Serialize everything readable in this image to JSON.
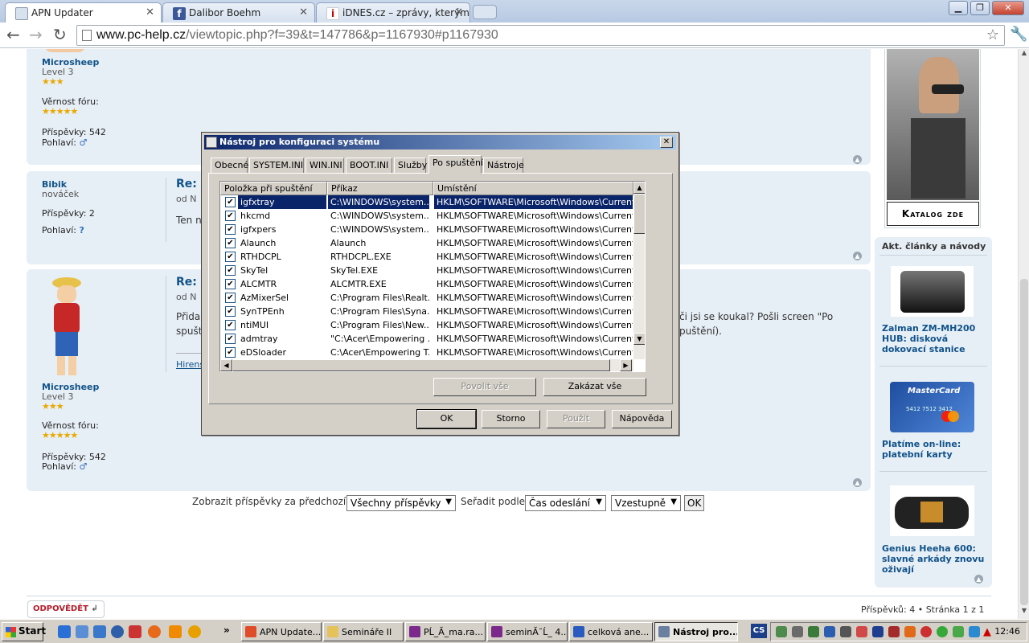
{
  "browser": {
    "tabs": [
      {
        "title": "APN Updater",
        "active": true
      },
      {
        "title": "Dalibor Boehm",
        "active": false
      },
      {
        "title": "iDNES.cz – zprávy, kterým m",
        "active": false
      }
    ],
    "url_host": "www.pc-help.cz",
    "url_path": "/viewtopic.php?f=39&t=147786&p=1167930#p1167930"
  },
  "page": {
    "post1": {
      "username": "Microsheep",
      "rank": "Level 3",
      "loyalty_label": "Věrnost fóru:",
      "posts_label": "Příspěvky:",
      "posts_value": "542",
      "gender_label": "Pohlaví:"
    },
    "post2": {
      "username": "Bibik",
      "rank": "nováček",
      "posts_label": "Příspěvky:",
      "posts_value": "2",
      "gender_label": "Pohlaví:",
      "title": "Re: A",
      "meta": "od N",
      "text": "Ten n"
    },
    "post3": {
      "username": "Microsheep",
      "rank": "Level 3",
      "loyalty_label": "Věrnost fóru:",
      "posts_label": "Příspěvky:",
      "posts_value": "542",
      "gender_label": "Pohlaví:",
      "title": "Re: A",
      "meta": "od N",
      "text_left1": "Přida",
      "text_left2": "spušt",
      "text_right1": "či jsi se koukal? Pošli screen \"Po",
      "text_right2": "puštění).",
      "signature": "Hirens"
    },
    "sort": {
      "show_label": "Zobrazit příspěvky za předchozí:",
      "show_value": "Všechny příspěvky",
      "sort_label": "Seřadit podle",
      "sort_value": "Čas odeslání",
      "order_value": "Vzestupně",
      "ok": "OK"
    },
    "reply_button": "ODPOVĚDĚT",
    "pagination": "Příspěvků: 4 • Stránka 1 z 1",
    "sidebar": {
      "ad_caption": "Katalog zde",
      "section_title": "Akt. články a návody",
      "articles": [
        "Zalman ZM-MH200 HUB: disková dokovací stanice",
        "Platíme on-line: platební karty",
        "Genius Heeha 600: slavné arkády znovu oživají"
      ],
      "card_brand": "MasterCard",
      "card_number": "5412 7512 3412"
    }
  },
  "dialog": {
    "title": "Nástroj pro konfiguraci systému",
    "tabs": [
      "Obecné",
      "SYSTEM.INI",
      "WIN.INI",
      "BOOT.INI",
      "Služby",
      "Po spuštění",
      "Nástroje"
    ],
    "columns": [
      "Položka při spuštění",
      "Příkaz",
      "Umístění"
    ],
    "rows": [
      {
        "item": "igfxtray",
        "command": "C:\\WINDOWS\\system...",
        "location": "HKLM\\SOFTWARE\\Microsoft\\Windows\\CurrentVer...",
        "checked": true
      },
      {
        "item": "hkcmd",
        "command": "C:\\WINDOWS\\system...",
        "location": "HKLM\\SOFTWARE\\Microsoft\\Windows\\CurrentVer...",
        "checked": true
      },
      {
        "item": "igfxpers",
        "command": "C:\\WINDOWS\\system...",
        "location": "HKLM\\SOFTWARE\\Microsoft\\Windows\\CurrentVer...",
        "checked": true
      },
      {
        "item": "Alaunch",
        "command": "Alaunch",
        "location": "HKLM\\SOFTWARE\\Microsoft\\Windows\\CurrentVer...",
        "checked": true
      },
      {
        "item": "RTHDCPL",
        "command": "RTHDCPL.EXE",
        "location": "HKLM\\SOFTWARE\\Microsoft\\Windows\\CurrentVer...",
        "checked": true
      },
      {
        "item": "SkyTel",
        "command": "SkyTel.EXE",
        "location": "HKLM\\SOFTWARE\\Microsoft\\Windows\\CurrentVer...",
        "checked": true
      },
      {
        "item": "ALCMTR",
        "command": "ALCMTR.EXE",
        "location": "HKLM\\SOFTWARE\\Microsoft\\Windows\\CurrentVer...",
        "checked": true
      },
      {
        "item": "AzMixerSel",
        "command": "C:\\Program Files\\Realt...",
        "location": "HKLM\\SOFTWARE\\Microsoft\\Windows\\CurrentVer...",
        "checked": true
      },
      {
        "item": "SynTPEnh",
        "command": "C:\\Program Files\\Syna...",
        "location": "HKLM\\SOFTWARE\\Microsoft\\Windows\\CurrentVer...",
        "checked": true
      },
      {
        "item": "ntiMUI",
        "command": "C:\\Program Files\\New...",
        "location": "HKLM\\SOFTWARE\\Microsoft\\Windows\\CurrentVer...",
        "checked": true
      },
      {
        "item": "admtray",
        "command": "\"C:\\Acer\\Empowering ...",
        "location": "HKLM\\SOFTWARE\\Microsoft\\Windows\\CurrentVer...",
        "checked": true
      },
      {
        "item": "eDSloader",
        "command": "C:\\Acer\\Empowering T...",
        "location": "HKLM\\SOFTWARE\\Microsoft\\Windows\\CurrentVer...",
        "checked": true
      }
    ],
    "enable_all": "Povolit vše",
    "disable_all": "Zakázat vše",
    "ok": "OK",
    "cancel": "Storno",
    "apply": "Použít",
    "help": "Nápověda"
  },
  "taskbar": {
    "start": "Start",
    "buttons": [
      {
        "label": "APN Update...",
        "color": "#e04b2a"
      },
      {
        "label": "Semináře II",
        "color": "#e6c25a"
      },
      {
        "label": "PĹ_Ă_ma.ra...",
        "color": "#7b2a8c"
      },
      {
        "label": "seminĂ˘Ĺ_ 4...",
        "color": "#7b2a8c"
      },
      {
        "label": "celková ane...",
        "color": "#2a5bbf"
      },
      {
        "label": "Nástroj pro...",
        "color": "#6b7fa0"
      }
    ],
    "lang": "CS",
    "clock": "12:46"
  },
  "colors": {
    "link_blue": "#105289",
    "post_bg": "#e7eff6",
    "selection": "#0a246a",
    "reply_red": "#b51b2a"
  }
}
